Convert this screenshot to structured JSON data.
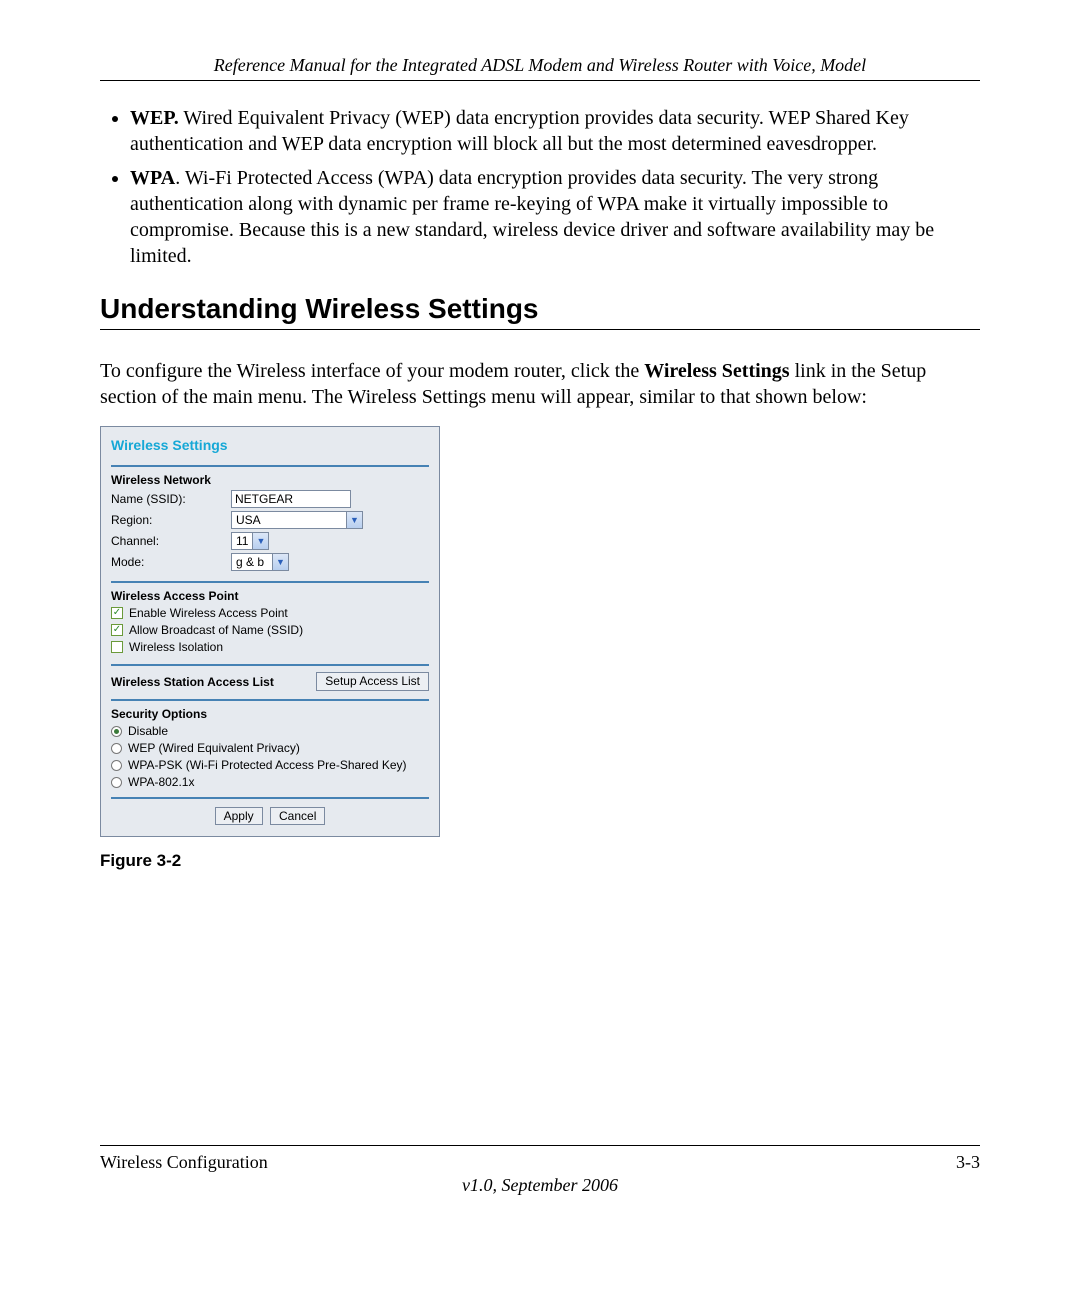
{
  "header": {
    "running": "Reference Manual for the Integrated ADSL Modem and Wireless Router with Voice, Model"
  },
  "bullets": {
    "wep": {
      "bold": "WEP.",
      "text": " Wired Equivalent Privacy (WEP) data encryption provides data security. WEP Shared Key authentication and WEP data encryption will block all but the most determined eavesdropper."
    },
    "wpa": {
      "bold": "WPA",
      "text": ". Wi-Fi Protected Access (WPA) data encryption provides data security. The very strong authentication along with dynamic per frame re-keying of WPA make it virtually impossible to compromise. Because this is a new standard, wireless device driver and software availability may be limited."
    }
  },
  "section": {
    "title": "Understanding Wireless Settings",
    "intro_pre": "To configure the Wireless interface of your modem router, click the ",
    "intro_bold": "Wireless Settings",
    "intro_post": " link in the Setup section of the main menu. The Wireless Settings menu will appear, similar to that shown below:"
  },
  "ui": {
    "title": "Wireless Settings",
    "network": {
      "heading": "Wireless Network",
      "name_label": "Name (SSID):",
      "name_value": "NETGEAR",
      "region_label": "Region:",
      "region_value": "USA",
      "channel_label": "Channel:",
      "channel_value": "11",
      "mode_label": "Mode:",
      "mode_value": "g & b"
    },
    "ap": {
      "heading": "Wireless Access Point",
      "enable": "Enable Wireless Access Point",
      "broadcast": "Allow Broadcast of Name (SSID)",
      "isolation": "Wireless Isolation"
    },
    "wsal": {
      "label": "Wireless Station Access List",
      "button": "Setup Access List"
    },
    "security": {
      "heading": "Security Options",
      "disable": "Disable",
      "wep": "WEP (Wired Equivalent Privacy)",
      "wpa_psk": "WPA-PSK (Wi-Fi Protected Access Pre-Shared Key)",
      "wpa_8021x": "WPA-802.1x"
    },
    "buttons": {
      "apply": "Apply",
      "cancel": "Cancel"
    }
  },
  "figure": {
    "caption": "Figure 3-2"
  },
  "footer": {
    "left": "Wireless Configuration",
    "right": "3-3",
    "version": "v1.0, September 2006"
  }
}
